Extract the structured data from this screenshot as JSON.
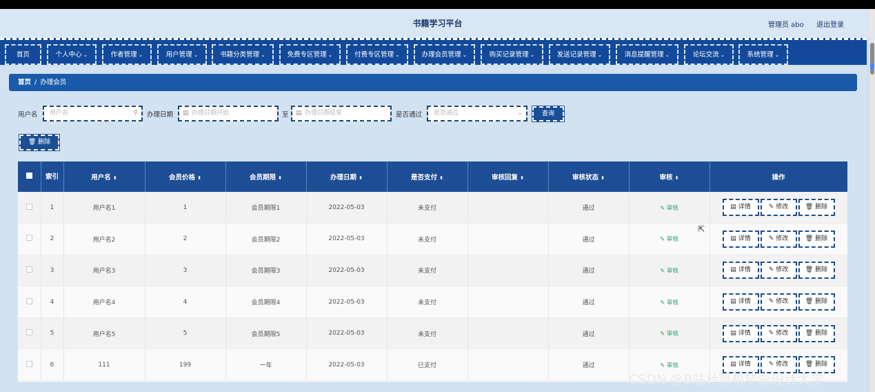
{
  "header": {
    "title": "书籍学习平台",
    "user": "管理员 abo",
    "logout": "退出登录"
  },
  "nav": [
    {
      "label": "首页",
      "chevron": false
    },
    {
      "label": "个人中心",
      "chevron": true
    },
    {
      "label": "作者管理",
      "chevron": true
    },
    {
      "label": "用户管理",
      "chevron": true
    },
    {
      "label": "书籍分类管理",
      "chevron": true
    },
    {
      "label": "免费专区管理",
      "chevron": true
    },
    {
      "label": "付费专区管理",
      "chevron": true
    },
    {
      "label": "办理会员管理",
      "chevron": true
    },
    {
      "label": "购买记录管理",
      "chevron": true
    },
    {
      "label": "发送记录管理",
      "chevron": true
    },
    {
      "label": "消息提醒管理",
      "chevron": true
    },
    {
      "label": "论坛交流",
      "chevron": true
    },
    {
      "label": "系统管理",
      "chevron": true
    }
  ],
  "breadcrumb": {
    "home": "首页",
    "separator": "/",
    "current": "办理会员"
  },
  "search": {
    "username_label": "用户名",
    "username_placeholder": "用户名",
    "date_label": "办理日期",
    "date_start_placeholder": "办理日期开始",
    "date_to": "至",
    "date_end_placeholder": "办理日期结束",
    "approved_label": "是否通过",
    "approved_placeholder": "是否通过",
    "query_button": "查询"
  },
  "delete_button": "删除",
  "table": {
    "columns": [
      "索引",
      "用户名",
      "会员价格",
      "会员期限",
      "办理日期",
      "是否支付",
      "审核回复",
      "审核状态",
      "审核",
      "操作"
    ],
    "rows": [
      {
        "index": "1",
        "username": "用户名1",
        "price": "1",
        "term": "会员期限1",
        "date": "2022-05-03",
        "paid": "未支付",
        "reply": "",
        "status": "通过"
      },
      {
        "index": "2",
        "username": "用户名2",
        "price": "2",
        "term": "会员期限2",
        "date": "2022-05-03",
        "paid": "未支付",
        "reply": "",
        "status": "通过"
      },
      {
        "index": "3",
        "username": "用户名3",
        "price": "3",
        "term": "会员期限3",
        "date": "2022-05-03",
        "paid": "未支付",
        "reply": "",
        "status": "通过"
      },
      {
        "index": "4",
        "username": "用户名4",
        "price": "4",
        "term": "会员期限4",
        "date": "2022-05-03",
        "paid": "未支付",
        "reply": "",
        "status": "通过"
      },
      {
        "index": "5",
        "username": "用户名5",
        "price": "5",
        "term": "会员期限5",
        "date": "2022-05-03",
        "paid": "未支付",
        "reply": "",
        "status": "通过"
      },
      {
        "index": "6",
        "username": "111",
        "price": "199",
        "term": "一年",
        "date": "2022-05-03",
        "paid": "已支付",
        "reply": "",
        "status": "通过"
      }
    ],
    "review_link": "审核",
    "actions": [
      "详情",
      "修改",
      "删除"
    ]
  },
  "watermark": "CSDN @B站计算机毕业设计大学"
}
